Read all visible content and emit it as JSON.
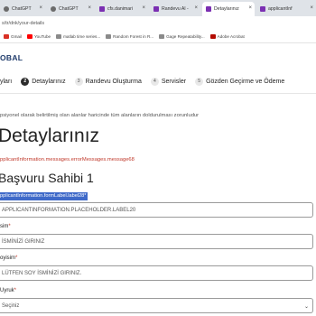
{
  "browser": {
    "tabs": [
      {
        "label": "ChatGPT"
      },
      {
        "label": "ChatGPT"
      },
      {
        "label": "cfs.danimari"
      },
      {
        "label": "Randevu Al -"
      },
      {
        "label": "Detaylarınız"
      },
      {
        "label": "applicantInf"
      }
    ],
    "close_glyph": "×",
    "address": "s/tr/dnk/your-details",
    "bookmarks": [
      {
        "label": "Gmail",
        "icon": "gmail-icon"
      },
      {
        "label": "YouTube",
        "icon": "youtube-icon"
      },
      {
        "label": "matlab time series...",
        "icon": "page-icon"
      },
      {
        "label": "Random Forest in R...",
        "icon": "page-icon"
      },
      {
        "label": "Gage Repeatability...",
        "icon": "page-icon"
      },
      {
        "label": "Adobe Acrobat",
        "icon": "acrobat-icon"
      }
    ]
  },
  "header": {
    "logo_text": "OBAL"
  },
  "stepper": {
    "steps": [
      {
        "number": "",
        "label": "yları"
      },
      {
        "number": "2",
        "label": "Detaylarınız"
      },
      {
        "number": "3",
        "label": "Randevu Oluşturma"
      },
      {
        "number": "4",
        "label": "Servisler"
      },
      {
        "number": "5",
        "label": "Gözden Geçirme ve Ödeme"
      }
    ]
  },
  "main": {
    "note": "psiyonel olarak belirtilmiş olan alanlar haricinde tüm alanların doldurulması zorunludur",
    "page_title": "Detaylarınız",
    "error_text": "pplicantInformation.messages.errorMessages.message68",
    "section_title": "Başvuru Sahibi 1",
    "selected_label": "pplicantInformation.formLabel.label28*",
    "field1_placeholder": "APPLICANTINFORMATION.PLACEHOLDER.LABEL20",
    "label_name": "sim",
    "field2_placeholder": "İSMİNİZİ GIRINIZ",
    "label_surname": "oyisim",
    "field3_placeholder": "LÜTFEN SOY İSMİNİZİ GIRINIZ.",
    "label_nationality": "Uyruk",
    "required_mark": "*",
    "select_value": "Seçiniz",
    "chevron": "⌄"
  },
  "colors": {
    "selection": "#3f6ac9",
    "error": "#c0392b",
    "step_active": "#2b2b2b",
    "brand": "#1f3b6b"
  }
}
